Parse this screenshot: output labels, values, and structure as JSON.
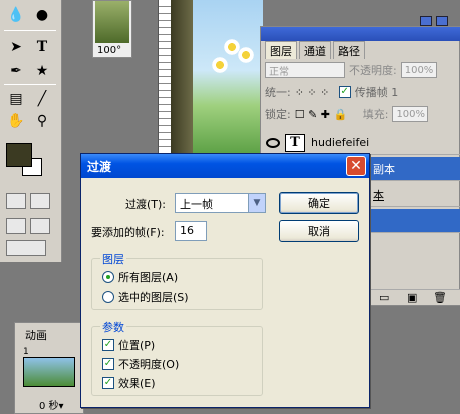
{
  "toolbox": {
    "tools": [
      "droplet-icon",
      "bucket-icon",
      "select-arrow-icon",
      "type-icon",
      "pen-icon",
      "shape-icon",
      "notes-icon",
      "eyedropper-icon",
      "hand-icon",
      "zoom-icon"
    ],
    "type_label": "T",
    "colors": {
      "foreground": "#3b3a22",
      "background": "#ffffff"
    }
  },
  "canvas": {
    "zoom": "100°"
  },
  "layers_panel": {
    "tabs": [
      "图层",
      "通道",
      "路径"
    ],
    "blend_mode": "正常",
    "opacity_label": "不透明度:",
    "opacity_value": "100%",
    "unify_label": "统一:",
    "propagate_label": "传播帧 1",
    "lock_label": "锁定:",
    "fill_label": "填充:",
    "fill_value": "100%",
    "layers": [
      {
        "name": "hudiefeifei",
        "type_glyph": "T"
      },
      {
        "name": "副本",
        "selected": true
      },
      {
        "name": "本"
      }
    ]
  },
  "animation_panel": {
    "tab": "动画",
    "frame_number": "1",
    "frame_time": "0 秒▾"
  },
  "dialog": {
    "title": "过渡",
    "close": "✕",
    "tween_with_label": "过渡(T):",
    "tween_with_value": "上一帧",
    "frames_to_add_label": "要添加的帧(F):",
    "frames_to_add_value": "16",
    "ok": "确定",
    "cancel": "取消",
    "layers_group": {
      "title": "图层",
      "options": [
        {
          "label": "所有图层(A)",
          "selected": true
        },
        {
          "label": "选中的图层(S)",
          "selected": false
        }
      ]
    },
    "params_group": {
      "title": "参数",
      "options": [
        {
          "label": "位置(P)",
          "checked": true
        },
        {
          "label": "不透明度(O)",
          "checked": true
        },
        {
          "label": "效果(E)",
          "checked": true
        }
      ]
    },
    "colors": {
      "title_bar": "#0054e3",
      "close": "#d74b2f",
      "group_title": "#0046d5"
    }
  }
}
